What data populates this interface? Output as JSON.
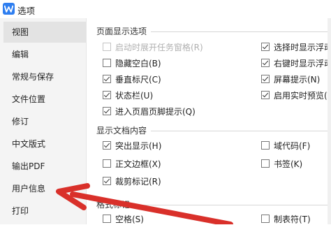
{
  "window": {
    "title": "选项",
    "app_icon": "wps-writer-icon"
  },
  "sidebar": {
    "items": [
      {
        "label": "视图",
        "active": true
      },
      {
        "label": "编辑"
      },
      {
        "label": "常规与保存"
      },
      {
        "label": "文件位置"
      },
      {
        "label": "修订"
      },
      {
        "label": "中文版式"
      },
      {
        "label": "输出PDF"
      },
      {
        "label": "用户信息"
      },
      {
        "label": "打印"
      }
    ]
  },
  "page_display": {
    "title": "页面显示选项",
    "options": [
      {
        "label": "启动时展开任务窗格(R)",
        "checked": false,
        "disabled": true
      },
      {
        "label": "隐藏空白(B)",
        "checked": false
      },
      {
        "label": "垂直标尺(C)",
        "checked": true
      },
      {
        "label": "状态栏(U)",
        "checked": true
      },
      {
        "label": "进入页眉页脚提示(Q)",
        "checked": true
      },
      {
        "label": "选择时显示浮动",
        "checked": true
      },
      {
        "label": "右键时显示浮动",
        "checked": true
      },
      {
        "label": "屏幕提示(N)",
        "checked": true
      },
      {
        "label": "启用实时预览(V",
        "checked": true
      }
    ]
  },
  "doc_content": {
    "title": "显示文档内容",
    "options": [
      {
        "label": "突出显示(H)",
        "checked": true
      },
      {
        "label": "正文边框(X)",
        "checked": false
      },
      {
        "label": "裁剪标记(R)",
        "checked": true
      },
      {
        "label": "域代码(F)",
        "checked": false
      },
      {
        "label": "书签(K)",
        "checked": false
      }
    ]
  },
  "format_marks": {
    "title": "格式标记",
    "options": [
      {
        "label": "空格(S)",
        "checked": false
      },
      {
        "label": "制表符(T)",
        "checked": false
      }
    ]
  },
  "colors": {
    "annotation_arrow": "#d9302a",
    "accent": "#2e7ef0"
  }
}
